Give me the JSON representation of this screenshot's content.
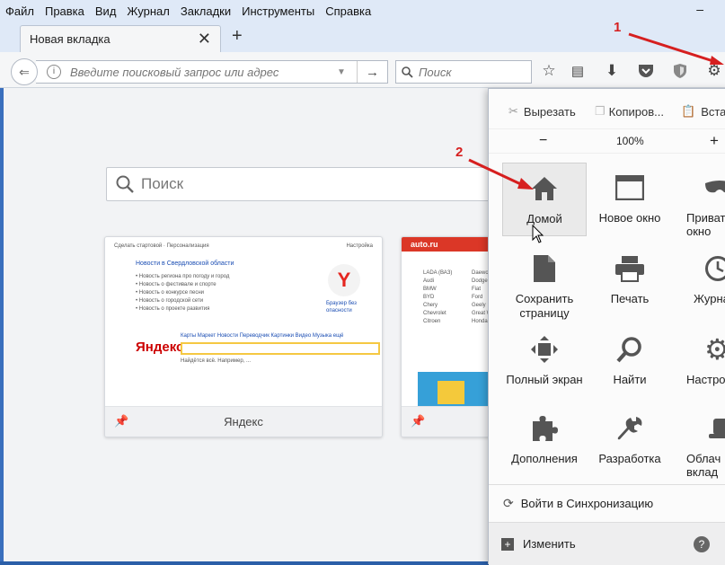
{
  "menubar": {
    "items": [
      "Файл",
      "Правка",
      "Вид",
      "Журнал",
      "Закладки",
      "Инструменты",
      "Справка"
    ],
    "minimize": "–"
  },
  "tab": {
    "title": "Новая вкладка",
    "close": "✕",
    "new": "+"
  },
  "navbar": {
    "url_placeholder": "Введите поисковый запрос или адрес",
    "search_placeholder": "Поиск"
  },
  "newtab": {
    "search_placeholder": "Поиск",
    "tiles": [
      {
        "title": "Яндекс"
      },
      {
        "title": ""
      }
    ],
    "yandex_preview": {
      "logo": "Яндекс",
      "heading": "Новости в Свердловской области",
      "browser_promo": "Браузер без опасности"
    },
    "auto_preview": {
      "logo": "auto.ru"
    }
  },
  "panel": {
    "edit": {
      "cut": "Вырезать",
      "copy": "Копиров...",
      "paste": "Вста"
    },
    "zoom": {
      "minus": "−",
      "value": "100%",
      "plus": "+"
    },
    "items": [
      {
        "name": "home",
        "label": "Домой",
        "icon": "home-icon"
      },
      {
        "name": "new-window",
        "label": "Новое окно",
        "icon": "window-icon"
      },
      {
        "name": "private",
        "label": "Приват окно",
        "icon": "mask-icon"
      },
      {
        "name": "save-page",
        "label": "Сохранить страницу",
        "icon": "page-icon"
      },
      {
        "name": "print",
        "label": "Печать",
        "icon": "printer-icon"
      },
      {
        "name": "history",
        "label": "Журна",
        "icon": "clock-icon"
      },
      {
        "name": "fullscreen",
        "label": "Полный экран",
        "icon": "fullscreen-icon"
      },
      {
        "name": "find",
        "label": "Найти",
        "icon": "magnifier-icon"
      },
      {
        "name": "settings",
        "label": "Настро",
        "icon": "gear-icon"
      },
      {
        "name": "addons",
        "label": "Дополнения",
        "icon": "puzzle-icon"
      },
      {
        "name": "developer",
        "label": "Разработка",
        "icon": "wrench-icon"
      },
      {
        "name": "cloud-tabs",
        "label": "Облач вклад",
        "icon": "hat-icon"
      }
    ],
    "sync": "Войти в Синхронизацию",
    "customize": "Изменить",
    "help": "?"
  },
  "annotations": {
    "one": "1",
    "two": "2"
  },
  "colors": {
    "annotation": "#d61f1f",
    "titlebar": "#dfe9f7",
    "panel": "#fbfbfb"
  }
}
